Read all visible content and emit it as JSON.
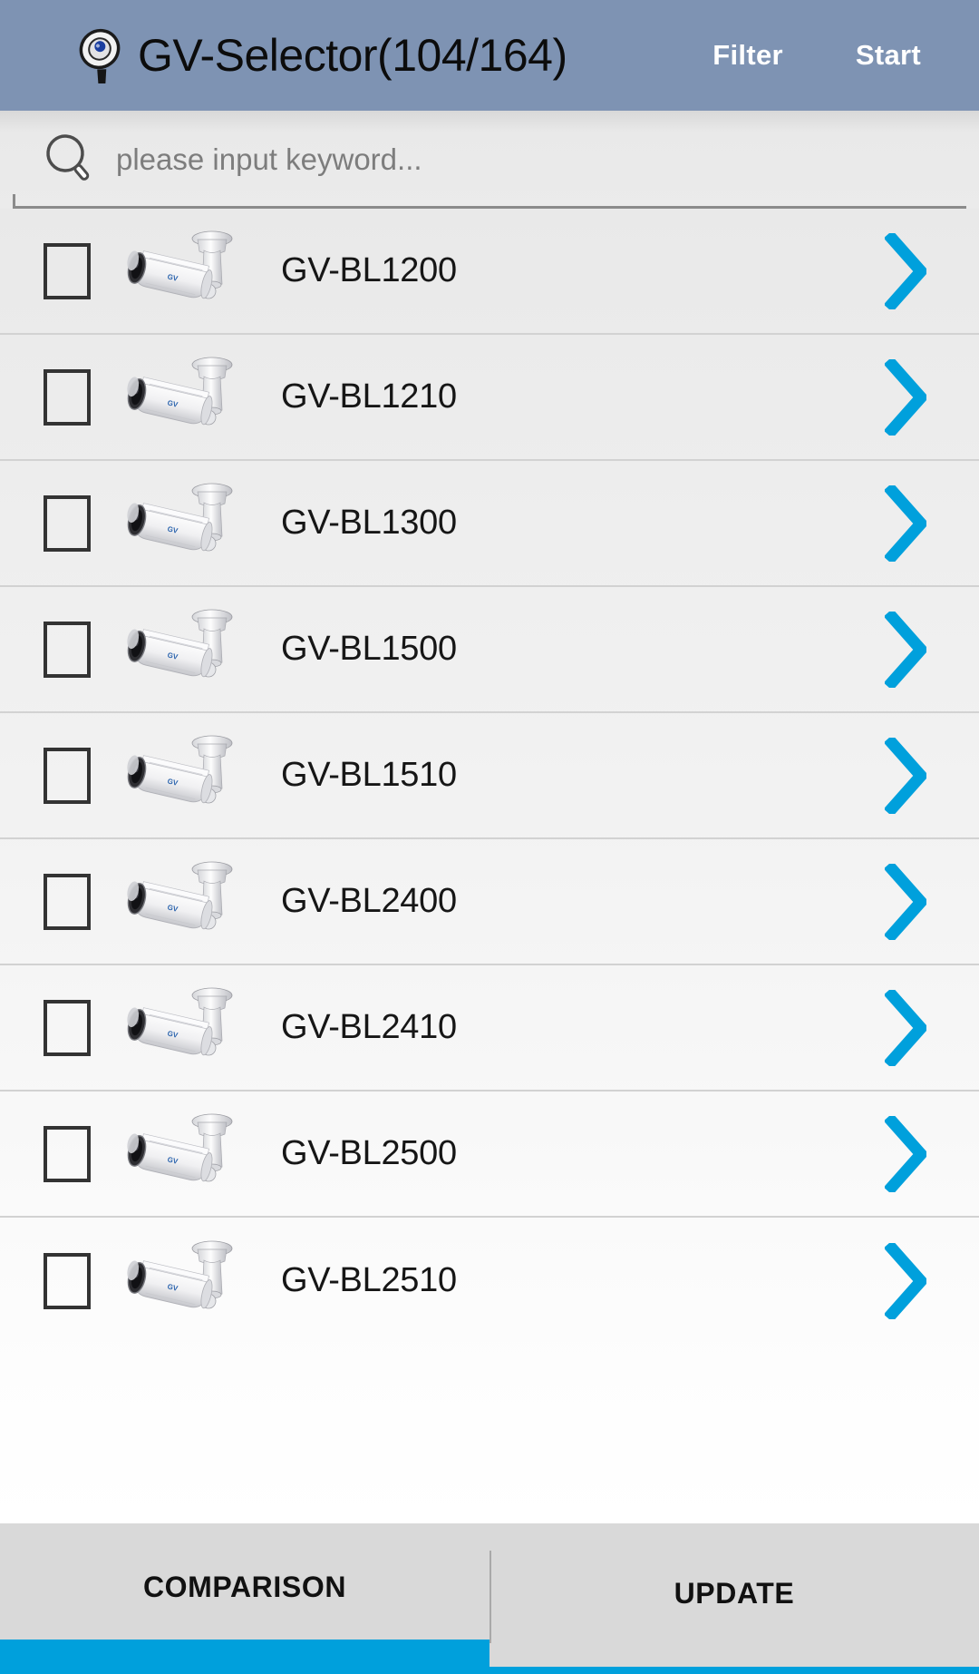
{
  "header": {
    "logo_icon": "magnifier-camera-logo",
    "title": "GV-Selector(104/164)",
    "filter_label": "Filter",
    "start_label": "Start",
    "bar_color": "#7e93b3",
    "title_color": "#0c0c0c",
    "action_color": "#ffffff"
  },
  "search": {
    "icon": "search-icon",
    "value": "",
    "placeholder": "please input keyword..."
  },
  "list": {
    "chevron_icon": "chevron-right-icon",
    "chevron_color": "#00a0dc",
    "thumbnail_icon": "bullet-camera-icon",
    "items": [
      {
        "label": "GV-BL1200",
        "checked": false
      },
      {
        "label": "GV-BL1210",
        "checked": false
      },
      {
        "label": "GV-BL1300",
        "checked": false
      },
      {
        "label": "GV-BL1500",
        "checked": false
      },
      {
        "label": "GV-BL1510",
        "checked": false
      },
      {
        "label": "GV-BL2400",
        "checked": false
      },
      {
        "label": "GV-BL2410",
        "checked": false
      },
      {
        "label": "GV-BL2500",
        "checked": false
      },
      {
        "label": "GV-BL2510",
        "checked": false
      }
    ]
  },
  "tabs": {
    "accent_color": "#00a0dc",
    "items": [
      {
        "label": "COMPARISON",
        "active": true
      },
      {
        "label": "UPDATE",
        "active": false
      }
    ]
  }
}
